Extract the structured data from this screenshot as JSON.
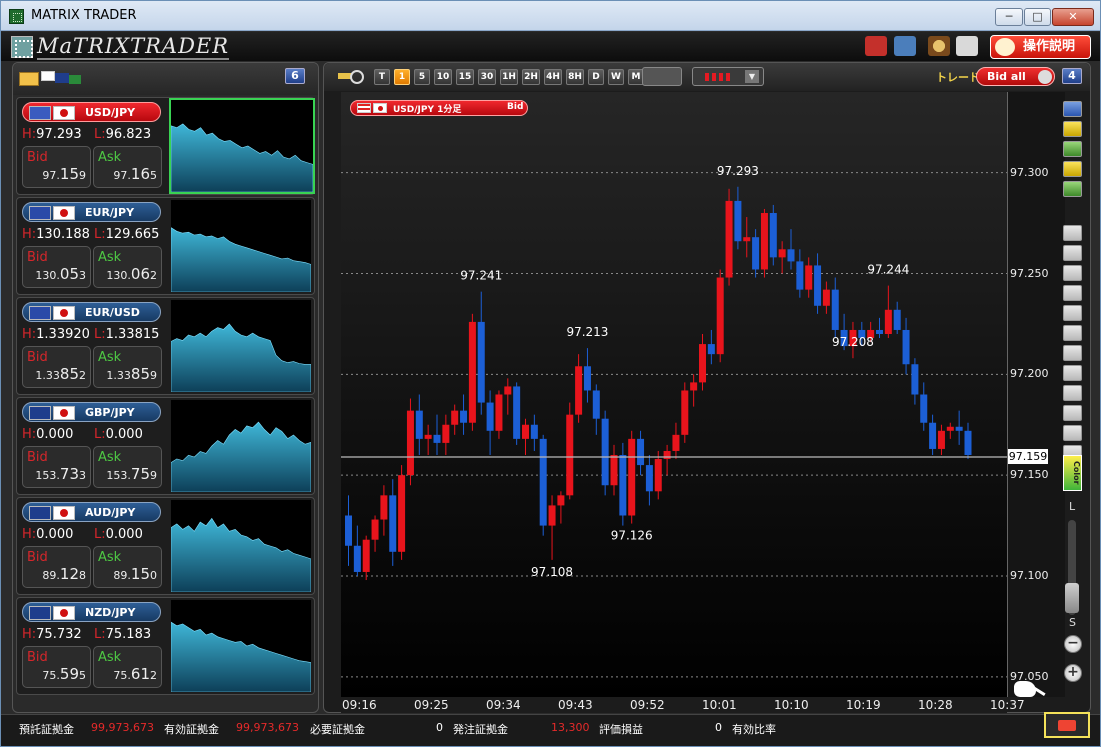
{
  "window": {
    "title": "MATRIX TRADER",
    "min": "─",
    "max": "□",
    "close": "✕"
  },
  "toolbar": {
    "logo_text": "MaTRIXTRADER",
    "help_label": "操作説明",
    "icons": [
      "toolbox-icon",
      "save-icon",
      "palette-icon",
      "print-icon"
    ]
  },
  "left_panel": {
    "badge": "6"
  },
  "pairs": [
    {
      "name": "USD/JPY",
      "active": true,
      "high_label": "H:",
      "high": "97.293",
      "low_label": "L:",
      "low": "96.823",
      "bid_label": "Bid",
      "ask_label": "Ask",
      "bid_small": "97.",
      "bid_big": "15",
      "bid_last": "9",
      "ask_small": "97.",
      "ask_big": "16",
      "ask_last": "5",
      "flag_a": "#3a5bbf",
      "spark": [
        0.72,
        0.7,
        0.74,
        0.68,
        0.66,
        0.7,
        0.62,
        0.64,
        0.58,
        0.55,
        0.56,
        0.52,
        0.48,
        0.5,
        0.46,
        0.42,
        0.44,
        0.4,
        0.45,
        0.38,
        0.36,
        0.4,
        0.34,
        0.32,
        0.3
      ]
    },
    {
      "name": "EUR/JPY",
      "active": false,
      "high_label": "H:",
      "high": "130.188",
      "low_label": "L:",
      "low": "129.665",
      "bid_label": "Bid",
      "ask_label": "Ask",
      "bid_small": "130.",
      "bid_big": "05",
      "bid_last": "3",
      "ask_small": "130.",
      "ask_big": "06",
      "ask_last": "2",
      "flag_a": "#2a4aa8",
      "spark": [
        0.7,
        0.66,
        0.64,
        0.65,
        0.62,
        0.63,
        0.6,
        0.61,
        0.58,
        0.6,
        0.55,
        0.52,
        0.5,
        0.48,
        0.46,
        0.44,
        0.42,
        0.4,
        0.38,
        0.36,
        0.37,
        0.34,
        0.33,
        0.32,
        0.3
      ]
    },
    {
      "name": "EUR/USD",
      "active": false,
      "high_label": "H:",
      "high": "1.33920",
      "low_label": "L:",
      "low": "1.33815",
      "bid_label": "Bid",
      "ask_label": "Ask",
      "bid_small": "1.33",
      "bid_big": "85",
      "bid_last": "2",
      "ask_small": "1.33",
      "ask_big": "85",
      "ask_last": "9",
      "flag_a": "#2a4aa8",
      "spark": [
        0.55,
        0.58,
        0.56,
        0.62,
        0.6,
        0.64,
        0.6,
        0.66,
        0.7,
        0.68,
        0.74,
        0.66,
        0.62,
        0.6,
        0.64,
        0.6,
        0.58,
        0.56,
        0.4,
        0.34,
        0.32,
        0.33,
        0.31,
        0.3,
        0.3
      ]
    },
    {
      "name": "GBP/JPY",
      "active": false,
      "high_label": "H:",
      "high": "0.000",
      "low_label": "L:",
      "low": "0.000",
      "bid_label": "Bid",
      "ask_label": "Ask",
      "bid_small": "153.",
      "bid_big": "73",
      "bid_last": "3",
      "ask_small": "153.",
      "ask_big": "75",
      "ask_last": "9",
      "flag_a": "#1f3d8c",
      "spark": [
        0.32,
        0.36,
        0.34,
        0.4,
        0.38,
        0.44,
        0.42,
        0.5,
        0.56,
        0.52,
        0.62,
        0.68,
        0.64,
        0.72,
        0.7,
        0.76,
        0.68,
        0.62,
        0.7,
        0.66,
        0.58,
        0.62,
        0.56,
        0.52,
        0.54
      ]
    },
    {
      "name": "AUD/JPY",
      "active": false,
      "high_label": "H:",
      "high": "0.000",
      "low_label": "L:",
      "low": "0.000",
      "bid_label": "Bid",
      "ask_label": "Ask",
      "bid_small": "89.",
      "bid_big": "12",
      "bid_last": "8",
      "ask_small": "89.",
      "ask_big": "15",
      "ask_last": "0",
      "flag_a": "#1f3d8c",
      "spark": [
        0.7,
        0.74,
        0.68,
        0.72,
        0.66,
        0.76,
        0.72,
        0.8,
        0.7,
        0.74,
        0.66,
        0.68,
        0.62,
        0.6,
        0.56,
        0.58,
        0.52,
        0.5,
        0.48,
        0.44,
        0.46,
        0.42,
        0.4,
        0.38,
        0.36
      ]
    },
    {
      "name": "NZD/JPY",
      "active": false,
      "high_label": "H:",
      "high": "75.732",
      "low_label": "L:",
      "low": "75.183",
      "bid_label": "Bid",
      "ask_label": "Ask",
      "bid_small": "75.",
      "bid_big": "59",
      "bid_last": "5",
      "ask_small": "75.",
      "ask_big": "61",
      "ask_last": "2",
      "flag_a": "#1f3d8c",
      "spark": [
        0.76,
        0.72,
        0.74,
        0.7,
        0.66,
        0.68,
        0.62,
        0.64,
        0.6,
        0.58,
        0.56,
        0.54,
        0.55,
        0.5,
        0.52,
        0.48,
        0.46,
        0.44,
        0.42,
        0.4,
        0.38,
        0.36,
        0.34,
        0.33,
        0.32
      ]
    }
  ],
  "chart_panel": {
    "badge": "4",
    "timeframes": [
      "T",
      "1",
      "5",
      "10",
      "15",
      "30",
      "1H",
      "2H",
      "4H",
      "8H",
      "D",
      "W",
      "M"
    ],
    "selected_timeframe": "1",
    "trade_label": "トレード",
    "bid_all_label": "Bid all",
    "tag_title": "USD/JPY 1分足",
    "tag_side": "Bid",
    "current_price": "97.159",
    "zoom_L": "L",
    "zoom_S": "S",
    "color_label": "Color"
  },
  "chart_data": {
    "type": "candlestick",
    "pair": "USD/JPY",
    "ylim": [
      97.04,
      97.34
    ],
    "y_ticks": [
      "97.300",
      "97.250",
      "97.200",
      "97.150",
      "97.100",
      "97.050"
    ],
    "y_tick_values": [
      97.3,
      97.25,
      97.2,
      97.15,
      97.1,
      97.05
    ],
    "x_ticks": [
      "09:16",
      "09:25",
      "09:34",
      "09:43",
      "09:52",
      "10:01",
      "10:10",
      "10:19",
      "10:28",
      "10:37"
    ],
    "current": 97.159,
    "annotations": [
      {
        "label": "97.241",
        "value": 97.241,
        "index": 15
      },
      {
        "label": "97.213",
        "value": 97.213,
        "index": 27
      },
      {
        "label": "97.108",
        "value": 97.108,
        "index": 23
      },
      {
        "label": "97.126",
        "value": 97.126,
        "index": 32
      },
      {
        "label": "97.293",
        "value": 97.293,
        "index": 44
      },
      {
        "label": "97.208",
        "value": 97.208,
        "index": 57
      },
      {
        "label": "97.244",
        "value": 97.244,
        "index": 61
      }
    ],
    "candles": [
      [
        97.13,
        97.14,
        97.105,
        97.115
      ],
      [
        97.115,
        97.125,
        97.1,
        97.102
      ],
      [
        97.102,
        97.12,
        97.098,
        97.118
      ],
      [
        97.118,
        97.13,
        97.112,
        97.128
      ],
      [
        97.128,
        97.145,
        97.12,
        97.14
      ],
      [
        97.14,
        97.148,
        97.105,
        97.112
      ],
      [
        97.112,
        97.155,
        97.108,
        97.15
      ],
      [
        97.15,
        97.188,
        97.145,
        97.182
      ],
      [
        97.182,
        97.19,
        97.16,
        97.168
      ],
      [
        97.168,
        97.175,
        97.16,
        97.17
      ],
      [
        97.17,
        97.18,
        97.16,
        97.166
      ],
      [
        97.166,
        97.18,
        97.16,
        97.175
      ],
      [
        97.175,
        97.185,
        97.17,
        97.182
      ],
      [
        97.182,
        97.19,
        97.17,
        97.176
      ],
      [
        97.176,
        97.23,
        97.172,
        97.226
      ],
      [
        97.226,
        97.241,
        97.18,
        97.186
      ],
      [
        97.186,
        97.192,
        97.16,
        97.172
      ],
      [
        97.172,
        97.192,
        97.168,
        97.19
      ],
      [
        97.19,
        97.198,
        97.18,
        97.194
      ],
      [
        97.194,
        97.196,
        97.165,
        97.168
      ],
      [
        97.168,
        97.178,
        97.16,
        97.175
      ],
      [
        97.175,
        97.18,
        97.162,
        97.168
      ],
      [
        97.168,
        97.17,
        97.12,
        97.125
      ],
      [
        97.125,
        97.14,
        97.108,
        97.135
      ],
      [
        97.135,
        97.142,
        97.126,
        97.14
      ],
      [
        97.14,
        97.186,
        97.138,
        97.18
      ],
      [
        97.18,
        97.21,
        97.176,
        97.204
      ],
      [
        97.204,
        97.213,
        97.186,
        97.192
      ],
      [
        97.192,
        97.195,
        97.17,
        97.178
      ],
      [
        97.178,
        97.182,
        97.14,
        97.145
      ],
      [
        97.145,
        97.165,
        97.14,
        97.16
      ],
      [
        97.16,
        97.166,
        97.125,
        97.13
      ],
      [
        97.13,
        97.172,
        97.126,
        97.168
      ],
      [
        97.168,
        97.172,
        97.15,
        97.155
      ],
      [
        97.155,
        97.16,
        97.135,
        97.142
      ],
      [
        97.142,
        97.162,
        97.138,
        97.158
      ],
      [
        97.158,
        97.165,
        97.15,
        97.162
      ],
      [
        97.162,
        97.176,
        97.158,
        97.17
      ],
      [
        97.17,
        97.196,
        97.166,
        97.192
      ],
      [
        97.192,
        97.2,
        97.184,
        97.196
      ],
      [
        97.196,
        97.22,
        97.192,
        97.215
      ],
      [
        97.215,
        97.222,
        97.205,
        97.21
      ],
      [
        97.21,
        97.252,
        97.206,
        97.248
      ],
      [
        97.248,
        97.292,
        97.244,
        97.286
      ],
      [
        97.286,
        97.293,
        97.262,
        97.266
      ],
      [
        97.266,
        97.278,
        97.258,
        97.268
      ],
      [
        97.268,
        97.272,
        97.248,
        97.252
      ],
      [
        97.252,
        97.282,
        97.248,
        97.28
      ],
      [
        97.28,
        97.284,
        97.254,
        97.258
      ],
      [
        97.258,
        97.266,
        97.25,
        97.262
      ],
      [
        97.262,
        97.272,
        97.252,
        97.256
      ],
      [
        97.256,
        97.262,
        97.238,
        97.242
      ],
      [
        97.242,
        97.258,
        97.238,
        97.254
      ],
      [
        97.254,
        97.26,
        97.23,
        97.234
      ],
      [
        97.234,
        97.246,
        97.23,
        97.242
      ],
      [
        97.242,
        97.248,
        97.218,
        97.222
      ],
      [
        97.222,
        97.23,
        97.212,
        97.214
      ],
      [
        97.214,
        97.226,
        97.208,
        97.222
      ],
      [
        97.222,
        97.226,
        97.214,
        97.218
      ],
      [
        97.218,
        97.226,
        97.216,
        97.222
      ],
      [
        97.222,
        97.228,
        97.218,
        97.22
      ],
      [
        97.22,
        97.244,
        97.218,
        97.232
      ],
      [
        97.232,
        97.236,
        97.22,
        97.222
      ],
      [
        97.222,
        97.228,
        97.2,
        97.205
      ],
      [
        97.205,
        97.208,
        97.185,
        97.19
      ],
      [
        97.19,
        97.196,
        97.172,
        97.176
      ],
      [
        97.176,
        97.18,
        97.16,
        97.163
      ],
      [
        97.163,
        97.175,
        97.16,
        97.172
      ],
      [
        97.172,
        97.176,
        97.168,
        97.174
      ],
      [
        97.174,
        97.182,
        97.165,
        97.172
      ],
      [
        97.172,
        97.176,
        97.158,
        97.16
      ]
    ]
  },
  "side_tools": [
    "info-icon",
    "news-icon",
    "chart-icon",
    "alarm-icon",
    "palette-tool-icon",
    "cursor-icon",
    "crosshair-icon",
    "trendline-icon",
    "hline-icon",
    "vline-icon",
    "fibonacci-icon",
    "channel-icon",
    "ruler-icon",
    "fan-icon",
    "text-icon",
    "eraser-icon",
    "trash-icon"
  ],
  "status": {
    "deposit_label": "預託証拠金",
    "deposit": "99,973,673",
    "effective_label": "有効証拠金",
    "effective": "99,973,673",
    "required_label": "必要証拠金",
    "required": "0",
    "order_label": "発注証拠金",
    "order": "13,300",
    "pnl_label": "評価損益",
    "pnl": "0",
    "ratio_label": "有効比率"
  }
}
